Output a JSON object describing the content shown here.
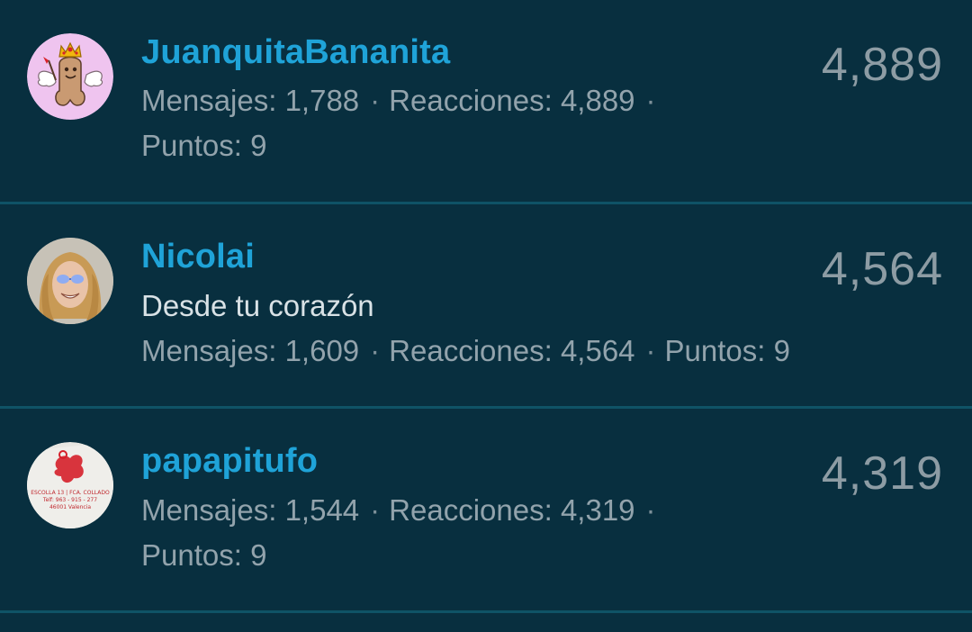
{
  "members": [
    {
      "username": "JuanquitaBananita",
      "score": "4,889",
      "messages_label": "Mensajes:",
      "messages": "1,788",
      "reactions_label": "Reacciones:",
      "reactions": "4,889",
      "points_label": "Puntos:",
      "points": "9",
      "avatar_icon": "crowned-winged-cartoon-avatar"
    },
    {
      "username": "Nicolai",
      "status": "Desde tu corazón",
      "score": "4,564",
      "messages_label": "Mensajes:",
      "messages": "1,609",
      "reactions_label": "Reacciones:",
      "reactions": "4,564",
      "points_label": "Puntos:",
      "points": "9",
      "avatar_icon": "smiling-person-photo-avatar"
    },
    {
      "username": "papapitufo",
      "score": "4,319",
      "messages_label": "Mensajes:",
      "messages": "1,544",
      "reactions_label": "Reacciones:",
      "reactions": "4,319",
      "points_label": "Puntos:",
      "points": "9",
      "avatar_icon": "stamped-receipt-avatar",
      "avatar_receipt_text": [
        "ESCOLLA 13 | FCA. COLLADO",
        "Telf: 963 - 915 - 277",
        "46001 Valencia"
      ]
    }
  ],
  "separator": "·",
  "colors": {
    "background": "#082f3f",
    "divider": "#0f5366",
    "username": "#1fa3d8",
    "meta_text": "#92a3ac",
    "status_text": "#d9e2e6",
    "score_text": "#8d9ca4"
  }
}
